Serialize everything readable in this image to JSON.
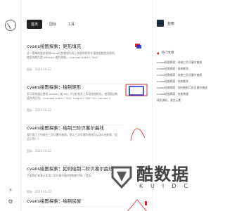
{
  "tabs": [
    {
      "label": "首页"
    },
    {
      "label": "国际"
    },
    {
      "label": "工具"
    }
  ],
  "posts": [
    {
      "title": "cvans绘图探索：矩形填充",
      "excerpt": "这一简单的要求绘制Wgux位的装矩形再上绘制的矩形在填充框颜色绘图的。使用的颜色是1NSstyle 着色绘制。<canvas width=\"300\" height=\"300\"...",
      "date": "国际 · 2023-10-22"
    },
    {
      "title": "cvans绘图探索：绘制矩形",
      "excerpt": "学习如何通过使用 stroke() 或 fill() 方法在矩形上实现绘制矩形。使用描边和填充的区别。<canvas width=\"300\" height=\"300\" id=\"canvas\"><script...",
      "date": "国际 · 2023-10-22"
    },
    {
      "title": "cvans绘图探索：绘制三阶贝塞尔曲线",
      "excerpt": "我们用了工作来在三次贝塞尔曲线，那么三次贝塞尔曲线可以怎么绘制呢（包括示例）？",
      "date": "国际 · 2023-10-22"
    },
    {
      "title": "cvans绘图探索：如何绘制二阶贝塞尔曲线",
      "excerpt": "下面我们来演示实现二阶贝塞尔曲线绘制的代码（包括...",
      "date": "国际 · 2023-10-22"
    },
    {
      "title": "cvans绘图探索：绘制房屋",
      "excerpt": "",
      "date": ""
    }
  ],
  "sidebar": {
    "author": "亚雨",
    "hot_title": "热门文章",
    "hot_items": [
      "cvans绘图探索：绘制三阶贝塞尔曲线",
      "cvans绘图探索：绘制矩形",
      "cvans绘图探索：绘制三阶贝塞尔曲线",
      "cvans绘图探索：绘制矩形",
      "cvans绘图探索：如何绘制二阶贝塞尔曲线",
      "cvans绘图探索：绘制房屋",
      "网页源码，原生元素"
    ]
  },
  "watermark": {
    "text": "酷数据",
    "sub": "KUIDC"
  },
  "colors": {
    "accent_red": "#e0262b",
    "accent_blue": "#1a2bd1",
    "tab_active_bg": "#222222"
  }
}
